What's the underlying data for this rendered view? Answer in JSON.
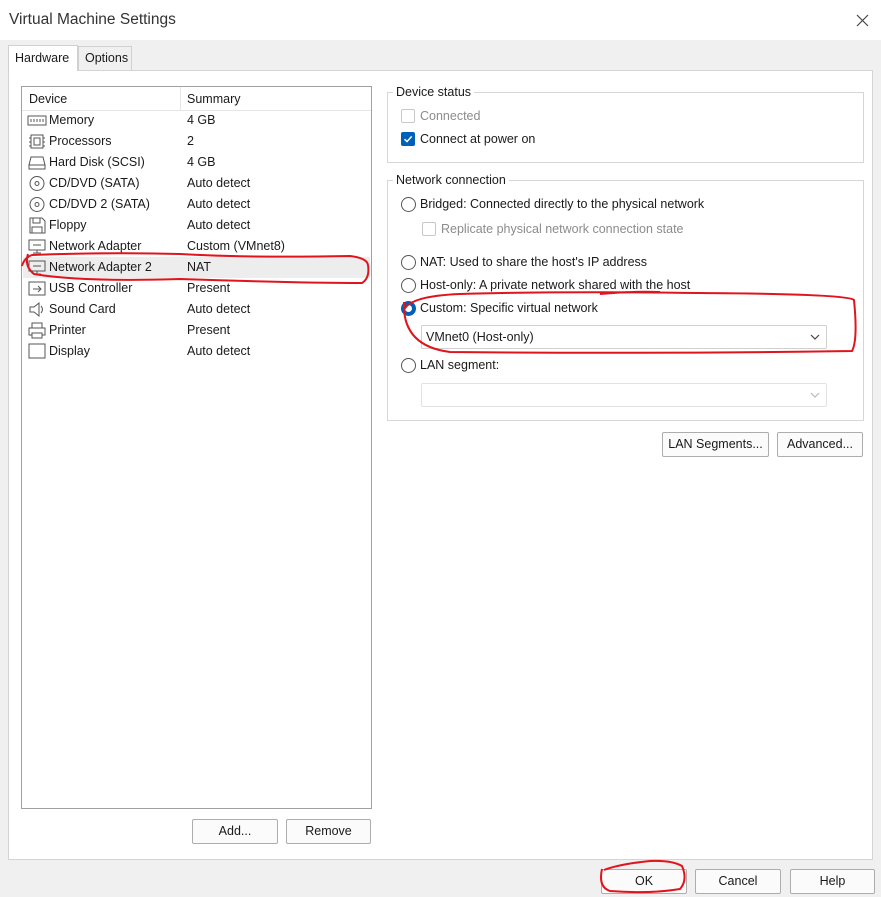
{
  "window": {
    "title": "Virtual Machine Settings",
    "close_icon": "close-icon"
  },
  "tabs": [
    {
      "label": "Hardware",
      "active": true
    },
    {
      "label": "Options",
      "active": false
    }
  ],
  "device_list": {
    "columns": {
      "device": "Device",
      "summary": "Summary"
    },
    "rows": [
      {
        "icon": "memory-icon",
        "name": "Memory",
        "summary": "4 GB",
        "selected": false
      },
      {
        "icon": "processor-icon",
        "name": "Processors",
        "summary": "2",
        "selected": false
      },
      {
        "icon": "hard-disk-icon",
        "name": "Hard Disk (SCSI)",
        "summary": "4 GB",
        "selected": false
      },
      {
        "icon": "cd-dvd-icon",
        "name": "CD/DVD (SATA)",
        "summary": "Auto detect",
        "selected": false
      },
      {
        "icon": "cd-dvd-icon",
        "name": "CD/DVD 2 (SATA)",
        "summary": "Auto detect",
        "selected": false
      },
      {
        "icon": "floppy-icon",
        "name": "Floppy",
        "summary": "Auto detect",
        "selected": false
      },
      {
        "icon": "network-adapter-icon",
        "name": "Network Adapter",
        "summary": "Custom (VMnet8)",
        "selected": false
      },
      {
        "icon": "network-adapter-icon",
        "name": "Network Adapter 2",
        "summary": "NAT",
        "selected": true
      },
      {
        "icon": "usb-icon",
        "name": "USB Controller",
        "summary": "Present",
        "selected": false
      },
      {
        "icon": "speaker-icon",
        "name": "Sound Card",
        "summary": "Auto detect",
        "selected": false
      },
      {
        "icon": "printer-icon",
        "name": "Printer",
        "summary": "Present",
        "selected": false
      },
      {
        "icon": "display-icon",
        "name": "Display",
        "summary": "Auto detect",
        "selected": false
      }
    ],
    "add_label": "Add...",
    "remove_label": "Remove"
  },
  "device_status": {
    "title": "Device status",
    "connected": {
      "label": "Connected",
      "checked": false,
      "enabled": false
    },
    "connect_at_power_on": {
      "label": "Connect at power on",
      "checked": true,
      "enabled": true
    }
  },
  "network_connection": {
    "title": "Network connection",
    "bridged": {
      "label": "Bridged: Connected directly to the physical network",
      "selected": false
    },
    "replicate": {
      "label": "Replicate physical network connection state",
      "checked": false,
      "enabled": false
    },
    "nat": {
      "label": "NAT: Used to share the host's IP address",
      "selected": false
    },
    "host_only": {
      "label": "Host-only: A private network shared with the host",
      "selected": false
    },
    "custom": {
      "label": "Custom: Specific virtual network",
      "selected": true,
      "value": "VMnet0 (Host-only)"
    },
    "lan_segment": {
      "label": "LAN segment:",
      "selected": false,
      "value": ""
    }
  },
  "side_buttons": {
    "lan_segments": "LAN Segments...",
    "advanced": "Advanced..."
  },
  "footer": {
    "ok": "OK",
    "cancel": "Cancel",
    "help": "Help"
  },
  "colors": {
    "accent": "#005fb8",
    "annotation": "#e0141c",
    "selection": "#ededed"
  }
}
